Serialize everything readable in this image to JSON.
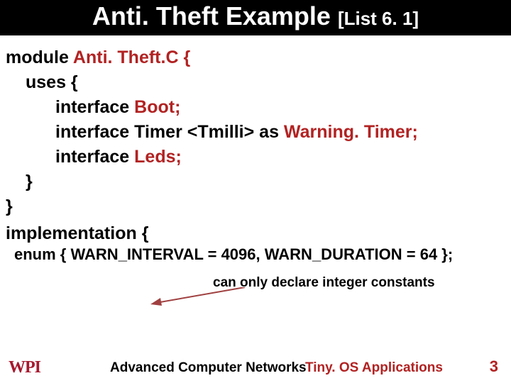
{
  "header": {
    "title": "Anti. Theft Example",
    "subtitle": "[List 6. 1]"
  },
  "code": {
    "l1_kw": "module",
    "l1_name": " Anti. Theft.C {",
    "l2_kw": "uses",
    "l2_rest": " {",
    "l3_kw": "interface",
    "l3_name": " Boot;",
    "l4_kw": "interface",
    "l4_mid": " Timer <Tmilli> ",
    "l4_as": "as",
    "l4_name": " Warning. Timer;",
    "l5_kw": "interface",
    "l5_name": " Leds;",
    "l6": "}",
    "l7": "}"
  },
  "impl": {
    "kw": "implementation",
    "rest": " {"
  },
  "note": "can only declare integer constants",
  "enum": {
    "kw": "enum",
    "body": " { WARN_INTERVAL = 4096, WARN_DURATION = 64 };"
  },
  "footer": {
    "left": "Advanced Computer Networks",
    "right": "Tiny. OS Applications",
    "page": "3",
    "logo": "WPI"
  }
}
